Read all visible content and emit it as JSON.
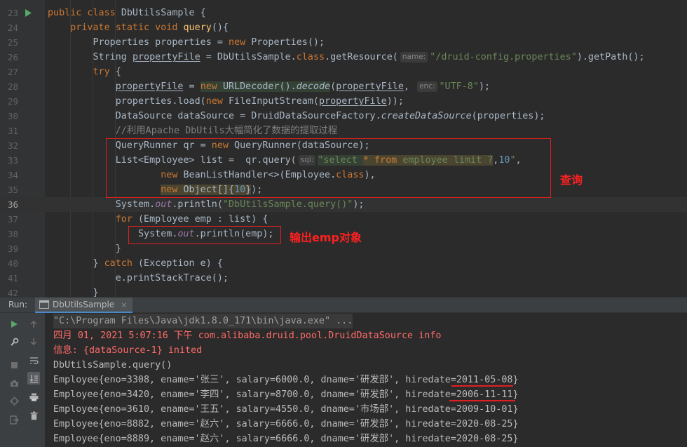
{
  "editor": {
    "lines": [
      {
        "num": "23",
        "run_marker": true,
        "parts": [
          [
            "kw",
            "public class "
          ],
          [
            "t",
            "DbUtilsSample {"
          ]
        ]
      },
      {
        "num": "24",
        "parts": [
          [
            "t",
            "    "
          ],
          [
            "kw",
            "private static void "
          ],
          [
            "fn",
            "query"
          ],
          [
            "t",
            "(){"
          ]
        ]
      },
      {
        "num": "25",
        "parts": [
          [
            "t",
            "        Properties properties = "
          ],
          [
            "kw",
            "new "
          ],
          [
            "t",
            "Properties();"
          ]
        ]
      },
      {
        "num": "26",
        "parts": [
          [
            "t",
            "        String "
          ],
          [
            "ul",
            "propertyFile"
          ],
          [
            "t",
            " = DbUtilsSample."
          ],
          [
            "kw",
            "class"
          ],
          [
            "t",
            ".getResource("
          ],
          [
            "hint",
            "name:"
          ],
          [
            "str",
            "\"/druid-config.properties\""
          ],
          [
            "t",
            ").getPath();"
          ]
        ]
      },
      {
        "num": "27",
        "parts": [
          [
            "t",
            "        "
          ],
          [
            "kw",
            "try "
          ],
          [
            "t",
            "{"
          ]
        ]
      },
      {
        "num": "28",
        "parts": [
          [
            "t",
            "            "
          ],
          [
            "ul",
            "propertyFile"
          ],
          [
            "t",
            " = "
          ],
          [
            "kwhl",
            "new "
          ],
          [
            "hl",
            "URLDecoder()."
          ],
          [
            "hlit",
            "decode"
          ],
          [
            "t",
            "("
          ],
          [
            "ul",
            "propertyFile"
          ],
          [
            "t",
            ", "
          ],
          [
            "hint",
            "enc:"
          ],
          [
            "str",
            "\"UTF-8\""
          ],
          [
            "t",
            ");"
          ]
        ]
      },
      {
        "num": "29",
        "parts": [
          [
            "t",
            "            properties.load("
          ],
          [
            "kw",
            "new "
          ],
          [
            "t",
            "FileInputStream("
          ],
          [
            "ul",
            "propertyFile"
          ],
          [
            "t",
            "));"
          ]
        ]
      },
      {
        "num": "30",
        "parts": [
          [
            "t",
            "            DataSource dataSource = DruidDataSourceFactory."
          ],
          [
            "it",
            "createDataSource"
          ],
          [
            "t",
            "(properties);"
          ]
        ]
      },
      {
        "num": "31",
        "parts": [
          [
            "t",
            "            "
          ],
          [
            "cmt",
            "//利用Apache DbUtils大幅简化了数据的提取过程"
          ]
        ]
      },
      {
        "num": "32",
        "parts": [
          [
            "t",
            "            QueryRunner qr = "
          ],
          [
            "kw",
            "new "
          ],
          [
            "t",
            "QueryRunner(dataSource);"
          ]
        ]
      },
      {
        "num": "33",
        "parts": [
          [
            "t",
            "            List<Employee> list =  qr.query("
          ],
          [
            "hint",
            "sql:"
          ],
          [
            "strhl",
            "\"select "
          ],
          [
            "kwhl2",
            "* from "
          ],
          [
            "strhl2",
            "employee limit ?"
          ],
          [
            "t",
            ","
          ],
          [
            "num",
            "10"
          ],
          [
            "str",
            "\""
          ],
          [
            "t",
            ","
          ]
        ]
      },
      {
        "num": "34",
        "parts": [
          [
            "t",
            "                    "
          ],
          [
            "kw",
            "new "
          ],
          [
            "t",
            "BeanListHandler<>(Employee."
          ],
          [
            "kw",
            "class"
          ],
          [
            "t",
            "),"
          ]
        ]
      },
      {
        "num": "35",
        "parts": [
          [
            "t",
            "                    "
          ],
          [
            "kwhl2",
            "new "
          ],
          [
            "hl2",
            "Object[]{"
          ],
          [
            "numhl2",
            "10"
          ],
          [
            "hl2",
            "}"
          ],
          [
            "t",
            ");"
          ]
        ]
      },
      {
        "num": "36",
        "current": true,
        "parts": [
          [
            "t",
            "            System."
          ],
          [
            "field",
            "out"
          ],
          [
            "t",
            ".println("
          ],
          [
            "str",
            "\"DbUtilsSample.query()\""
          ],
          [
            "t",
            ");"
          ]
        ]
      },
      {
        "num": "37",
        "parts": [
          [
            "t",
            "            "
          ],
          [
            "kw",
            "for "
          ],
          [
            "t",
            "(Employee emp : list) {"
          ]
        ]
      },
      {
        "num": "38",
        "parts": [
          [
            "t",
            "                System."
          ],
          [
            "field",
            "out"
          ],
          [
            "t",
            ".println(emp);"
          ]
        ]
      },
      {
        "num": "39",
        "parts": [
          [
            "t",
            "            }"
          ]
        ]
      },
      {
        "num": "40",
        "parts": [
          [
            "t",
            "        } "
          ],
          [
            "kw",
            "catch "
          ],
          [
            "t",
            "(Exception e) {"
          ]
        ]
      },
      {
        "num": "41",
        "parts": [
          [
            "t",
            "            e.printStackTrace();"
          ]
        ]
      },
      {
        "num": "42",
        "parts": [
          [
            "t",
            "        }"
          ]
        ]
      }
    ],
    "annotations": {
      "query_label": "查询",
      "print_label": "输出emp对象"
    }
  },
  "run_panel": {
    "label": "Run:",
    "tab_label": "DbUtilsSample",
    "close_glyph": "×",
    "console": [
      {
        "text": "\"C:\\Program Files\\Java\\jdk1.8.0_171\\bin\\java.exe\" ...",
        "style": "cmd"
      },
      {
        "text": "四月 01, 2021 5:07:16 下午 com.alibaba.druid.pool.DruidDataSource info",
        "style": "err"
      },
      {
        "text": "信息: {dataSource-1} inited",
        "style": "err"
      },
      {
        "text": "DbUtilsSample.query()",
        "style": "out"
      },
      {
        "text": "Employee{eno=3308, ename='张三', salary=6000.0, dname='研发部', hiredate=2011-05-08}",
        "style": "out"
      },
      {
        "text": "Employee{eno=3420, ename='李四', salary=8700.0, dname='研发部', hiredate=2006-11-11}",
        "style": "out"
      },
      {
        "text": "Employee{eno=3610, ename='王五', salary=4550.0, dname='市场部', hiredate=2009-10-01}",
        "style": "out"
      },
      {
        "text": "Employee{eno=8882, ename='赵六', salary=6666.0, dname='研发部', hiredate=2020-08-25}",
        "style": "out"
      },
      {
        "text": "Employee{eno=8889, ename='赵六', salary=6666.0, dname='研发部', hiredate=2020-08-25}",
        "style": "out"
      }
    ]
  },
  "colors": {
    "editor_bg": "#2b2b2b",
    "keyword": "#cc7832",
    "string": "#6a8759",
    "number": "#6897bb",
    "method": "#ffc66d",
    "annotation_red": "#e02020"
  },
  "icons": [
    "run-gutter-icon",
    "run-icon",
    "wrench-icon",
    "stop-icon",
    "camera-icon",
    "layout-icon",
    "rerun-icon",
    "up-arrow-icon",
    "down-arrow-icon",
    "soft-wrap-icon",
    "scroll-end-icon",
    "print-icon",
    "trash-icon"
  ]
}
